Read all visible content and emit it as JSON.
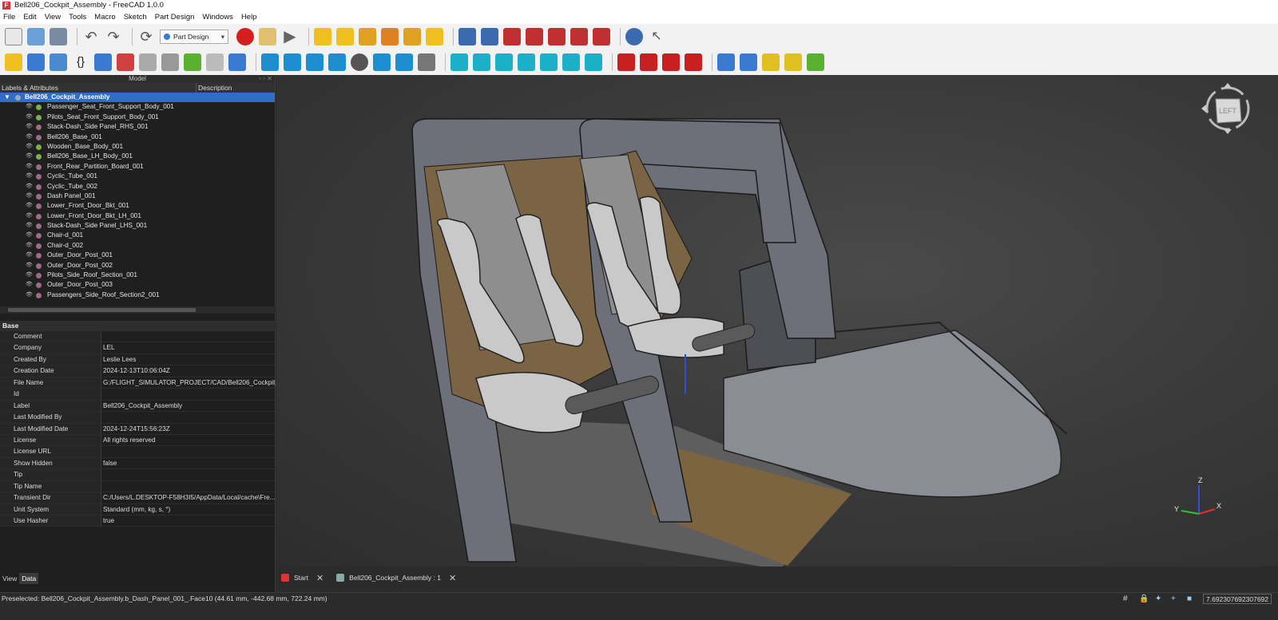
{
  "app": {
    "title": "Bell206_Cockpit_Assembly - FreeCAD 1.0.0",
    "logo_letter": "F"
  },
  "menu": [
    "File",
    "Edit",
    "View",
    "Tools",
    "Macro",
    "Sketch",
    "Part Design",
    "Windows",
    "Help"
  ],
  "toolbar": {
    "workbench": "Part Design"
  },
  "model_panel": {
    "title": "Model",
    "col_labels": "Labels & Attributes",
    "col_description": "Description"
  },
  "tree": {
    "root": "Bell206_Cockpit_Assembly",
    "items": [
      {
        "label": "Passenger_Seat_Front_Support_Body_001",
        "color": "#7ab04a"
      },
      {
        "label": "Pilots_Seat_Front_Support_Body_001",
        "color": "#7ab04a"
      },
      {
        "label": "Stack-Dash_Side Panel_RHS_001",
        "color": "#a06a8a"
      },
      {
        "label": "Bell206_Base_001",
        "color": "#a06a8a"
      },
      {
        "label": "Wooden_Base_Body_001",
        "color": "#7ab04a"
      },
      {
        "label": "Bell206_Base_LH_Body_001",
        "color": "#7ab04a"
      },
      {
        "label": "Front_Rear_Partition_Board_001",
        "color": "#a06a8a"
      },
      {
        "label": "Cyclic_Tube_001",
        "color": "#a06a8a"
      },
      {
        "label": "Cyclic_Tube_002",
        "color": "#a06a8a"
      },
      {
        "label": "Dash Panel_001",
        "color": "#a06a8a"
      },
      {
        "label": "Lower_Front_Door_Bkt_001",
        "color": "#a06a8a"
      },
      {
        "label": "Lower_Front_Door_Bkt_LH_001",
        "color": "#a06a8a"
      },
      {
        "label": "Stack-Dash_Side Panel_LHS_001",
        "color": "#a06a8a"
      },
      {
        "label": "Chair-d_001",
        "color": "#a06a8a"
      },
      {
        "label": "Chair-d_002",
        "color": "#a06a8a"
      },
      {
        "label": "Outer_Door_Post_001",
        "color": "#a06a8a"
      },
      {
        "label": "Outer_Door_Post_002",
        "color": "#a06a8a"
      },
      {
        "label": "Pilots_Side_Roof_Section_001",
        "color": "#a06a8a"
      },
      {
        "label": "Outer_Door_Post_003",
        "color": "#a06a8a"
      },
      {
        "label": "Passengers_Side_Roof_Section2_001",
        "color": "#a06a8a"
      }
    ]
  },
  "properties": {
    "group": "Base",
    "rows": [
      {
        "key": "Comment",
        "value": ""
      },
      {
        "key": "Company",
        "value": "LEL"
      },
      {
        "key": "Created By",
        "value": "Leslie Lees"
      },
      {
        "key": "Creation Date",
        "value": "2024-12-13T10:06:04Z"
      },
      {
        "key": "File Name",
        "value": "G:/FLIGHT_SIMULATOR_PROJECT/CAD/Bell206_Cockpit_..."
      },
      {
        "key": "Id",
        "value": ""
      },
      {
        "key": "Label",
        "value": "Bell206_Cockpit_Assembly"
      },
      {
        "key": "Last Modified By",
        "value": ""
      },
      {
        "key": "Last Modified Date",
        "value": "2024-12-24T15:56:23Z"
      },
      {
        "key": "License",
        "value": "All rights reserved"
      },
      {
        "key": "License URL",
        "value": ""
      },
      {
        "key": "Show Hidden",
        "value": "false"
      },
      {
        "key": "Tip",
        "value": ""
      },
      {
        "key": "Tip Name",
        "value": ""
      },
      {
        "key": "Transient Dir",
        "value": "C:/Users/L.DESKTOP-F58H3I5/AppData/Local/cache\\Fre..."
      },
      {
        "key": "Unit System",
        "value": "Standard (mm, kg, s, °)"
      },
      {
        "key": "Use Hasher",
        "value": "true"
      }
    ]
  },
  "panel_tabs": {
    "view": "View",
    "data": "Data"
  },
  "doc_tabs": [
    {
      "label": "Start"
    },
    {
      "label": "Bell206_Cockpit_Assembly : 1"
    }
  ],
  "navcube": {
    "face": "LEFT"
  },
  "axes": {
    "x": "X",
    "y": "Y",
    "z": "Z"
  },
  "status": {
    "message": "Preselected: Bell206_Cockpit_Assembly.b_Dash_Panel_001_.Face10 (44.61 mm, -442.68 mm, 722.24 mm)",
    "zoom": "7.692307692307692"
  },
  "colors": {
    "selection": "#2f6ec7",
    "background": "#2b2b2b"
  }
}
